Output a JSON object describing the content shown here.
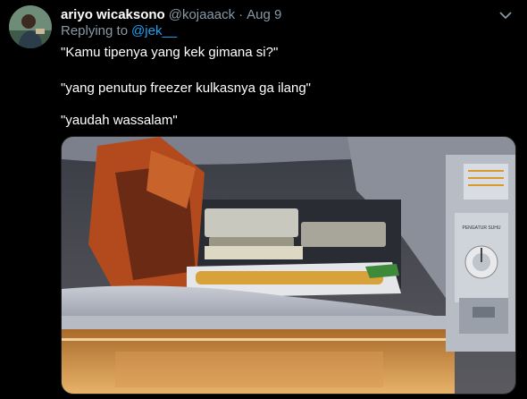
{
  "tweet": {
    "author_name": "ariyo wicaksono",
    "handle": "@kojaaack",
    "separator": "·",
    "date": "Aug 9",
    "replying_label": "Replying to",
    "replying_to": "@jek__",
    "lines": [
      "\"Kamu tipenya yang kek gimana si?\"",
      "\"yang penutup freezer kulkasnya ga ilang\"",
      "\"yaudah wassalam\""
    ],
    "more_icon": "chevron-down-icon"
  },
  "media": {
    "freezer_dial_label": "PENGATUR SUHU"
  }
}
